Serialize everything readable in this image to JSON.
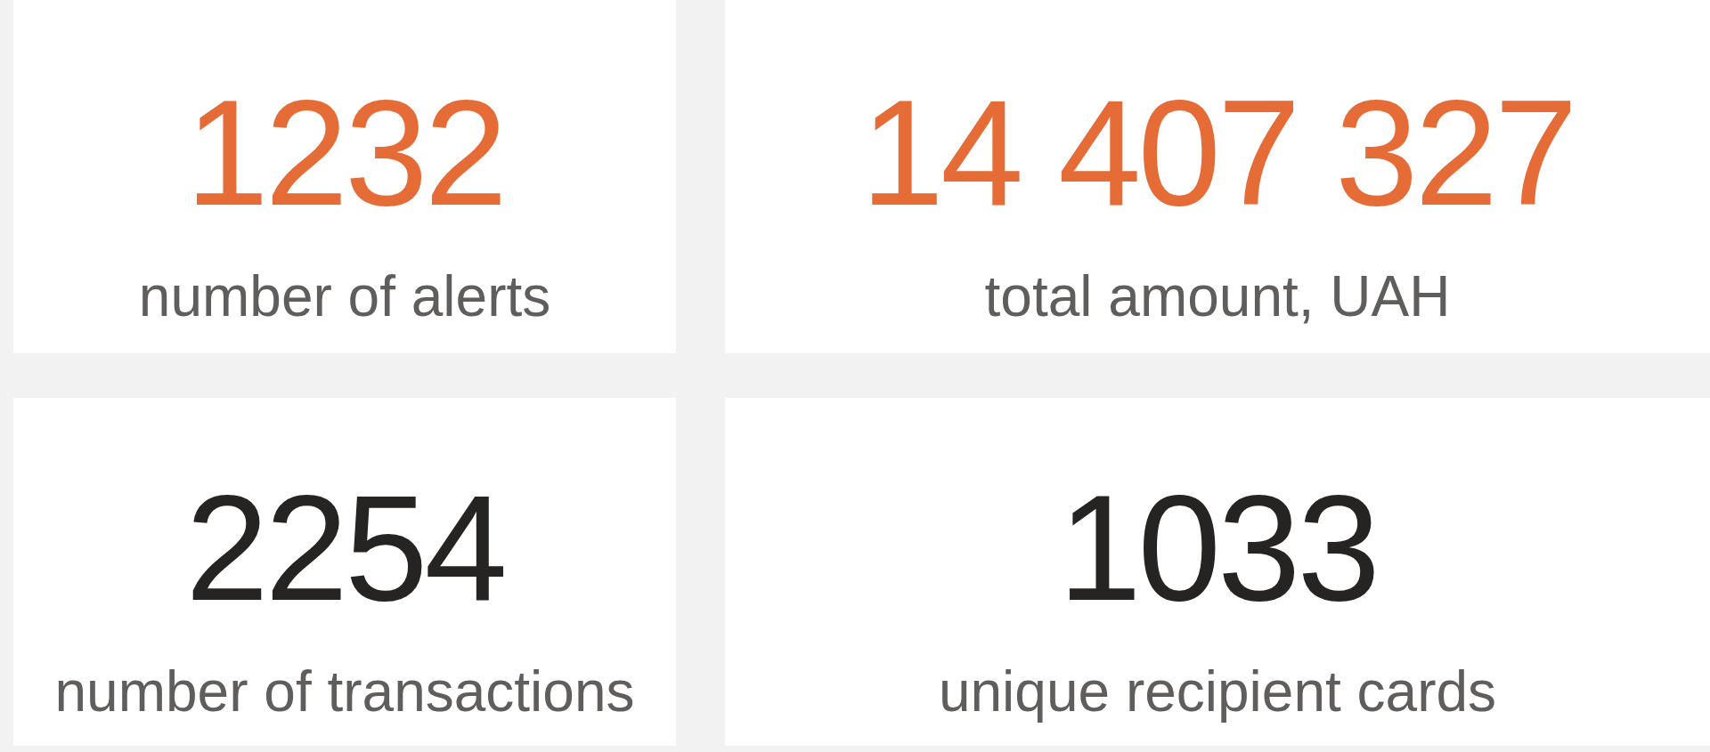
{
  "cards": [
    {
      "value": "1232",
      "label": "number of alerts",
      "color": "#e66c37"
    },
    {
      "value": "14 407 327",
      "label": "total amount, UAH",
      "color": "#e66c37"
    },
    {
      "value": "2254",
      "label": "number of transactions",
      "color": "#252423"
    },
    {
      "value": "1033",
      "label": "unique recipient cards",
      "color": "#252423"
    }
  ]
}
